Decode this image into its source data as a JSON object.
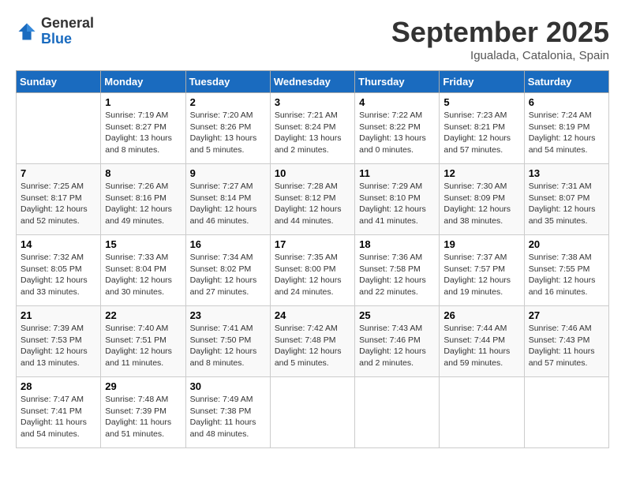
{
  "logo": {
    "general": "General",
    "blue": "Blue"
  },
  "title": "September 2025",
  "location": "Igualada, Catalonia, Spain",
  "weekdays": [
    "Sunday",
    "Monday",
    "Tuesday",
    "Wednesday",
    "Thursday",
    "Friday",
    "Saturday"
  ],
  "weeks": [
    [
      {
        "day": "",
        "info": ""
      },
      {
        "day": "1",
        "info": "Sunrise: 7:19 AM\nSunset: 8:27 PM\nDaylight: 13 hours\nand 8 minutes."
      },
      {
        "day": "2",
        "info": "Sunrise: 7:20 AM\nSunset: 8:26 PM\nDaylight: 13 hours\nand 5 minutes."
      },
      {
        "day": "3",
        "info": "Sunrise: 7:21 AM\nSunset: 8:24 PM\nDaylight: 13 hours\nand 2 minutes."
      },
      {
        "day": "4",
        "info": "Sunrise: 7:22 AM\nSunset: 8:22 PM\nDaylight: 13 hours\nand 0 minutes."
      },
      {
        "day": "5",
        "info": "Sunrise: 7:23 AM\nSunset: 8:21 PM\nDaylight: 12 hours\nand 57 minutes."
      },
      {
        "day": "6",
        "info": "Sunrise: 7:24 AM\nSunset: 8:19 PM\nDaylight: 12 hours\nand 54 minutes."
      }
    ],
    [
      {
        "day": "7",
        "info": "Sunrise: 7:25 AM\nSunset: 8:17 PM\nDaylight: 12 hours\nand 52 minutes."
      },
      {
        "day": "8",
        "info": "Sunrise: 7:26 AM\nSunset: 8:16 PM\nDaylight: 12 hours\nand 49 minutes."
      },
      {
        "day": "9",
        "info": "Sunrise: 7:27 AM\nSunset: 8:14 PM\nDaylight: 12 hours\nand 46 minutes."
      },
      {
        "day": "10",
        "info": "Sunrise: 7:28 AM\nSunset: 8:12 PM\nDaylight: 12 hours\nand 44 minutes."
      },
      {
        "day": "11",
        "info": "Sunrise: 7:29 AM\nSunset: 8:10 PM\nDaylight: 12 hours\nand 41 minutes."
      },
      {
        "day": "12",
        "info": "Sunrise: 7:30 AM\nSunset: 8:09 PM\nDaylight: 12 hours\nand 38 minutes."
      },
      {
        "day": "13",
        "info": "Sunrise: 7:31 AM\nSunset: 8:07 PM\nDaylight: 12 hours\nand 35 minutes."
      }
    ],
    [
      {
        "day": "14",
        "info": "Sunrise: 7:32 AM\nSunset: 8:05 PM\nDaylight: 12 hours\nand 33 minutes."
      },
      {
        "day": "15",
        "info": "Sunrise: 7:33 AM\nSunset: 8:04 PM\nDaylight: 12 hours\nand 30 minutes."
      },
      {
        "day": "16",
        "info": "Sunrise: 7:34 AM\nSunset: 8:02 PM\nDaylight: 12 hours\nand 27 minutes."
      },
      {
        "day": "17",
        "info": "Sunrise: 7:35 AM\nSunset: 8:00 PM\nDaylight: 12 hours\nand 24 minutes."
      },
      {
        "day": "18",
        "info": "Sunrise: 7:36 AM\nSunset: 7:58 PM\nDaylight: 12 hours\nand 22 minutes."
      },
      {
        "day": "19",
        "info": "Sunrise: 7:37 AM\nSunset: 7:57 PM\nDaylight: 12 hours\nand 19 minutes."
      },
      {
        "day": "20",
        "info": "Sunrise: 7:38 AM\nSunset: 7:55 PM\nDaylight: 12 hours\nand 16 minutes."
      }
    ],
    [
      {
        "day": "21",
        "info": "Sunrise: 7:39 AM\nSunset: 7:53 PM\nDaylight: 12 hours\nand 13 minutes."
      },
      {
        "day": "22",
        "info": "Sunrise: 7:40 AM\nSunset: 7:51 PM\nDaylight: 12 hours\nand 11 minutes."
      },
      {
        "day": "23",
        "info": "Sunrise: 7:41 AM\nSunset: 7:50 PM\nDaylight: 12 hours\nand 8 minutes."
      },
      {
        "day": "24",
        "info": "Sunrise: 7:42 AM\nSunset: 7:48 PM\nDaylight: 12 hours\nand 5 minutes."
      },
      {
        "day": "25",
        "info": "Sunrise: 7:43 AM\nSunset: 7:46 PM\nDaylight: 12 hours\nand 2 minutes."
      },
      {
        "day": "26",
        "info": "Sunrise: 7:44 AM\nSunset: 7:44 PM\nDaylight: 11 hours\nand 59 minutes."
      },
      {
        "day": "27",
        "info": "Sunrise: 7:46 AM\nSunset: 7:43 PM\nDaylight: 11 hours\nand 57 minutes."
      }
    ],
    [
      {
        "day": "28",
        "info": "Sunrise: 7:47 AM\nSunset: 7:41 PM\nDaylight: 11 hours\nand 54 minutes."
      },
      {
        "day": "29",
        "info": "Sunrise: 7:48 AM\nSunset: 7:39 PM\nDaylight: 11 hours\nand 51 minutes."
      },
      {
        "day": "30",
        "info": "Sunrise: 7:49 AM\nSunset: 7:38 PM\nDaylight: 11 hours\nand 48 minutes."
      },
      {
        "day": "",
        "info": ""
      },
      {
        "day": "",
        "info": ""
      },
      {
        "day": "",
        "info": ""
      },
      {
        "day": "",
        "info": ""
      }
    ]
  ]
}
